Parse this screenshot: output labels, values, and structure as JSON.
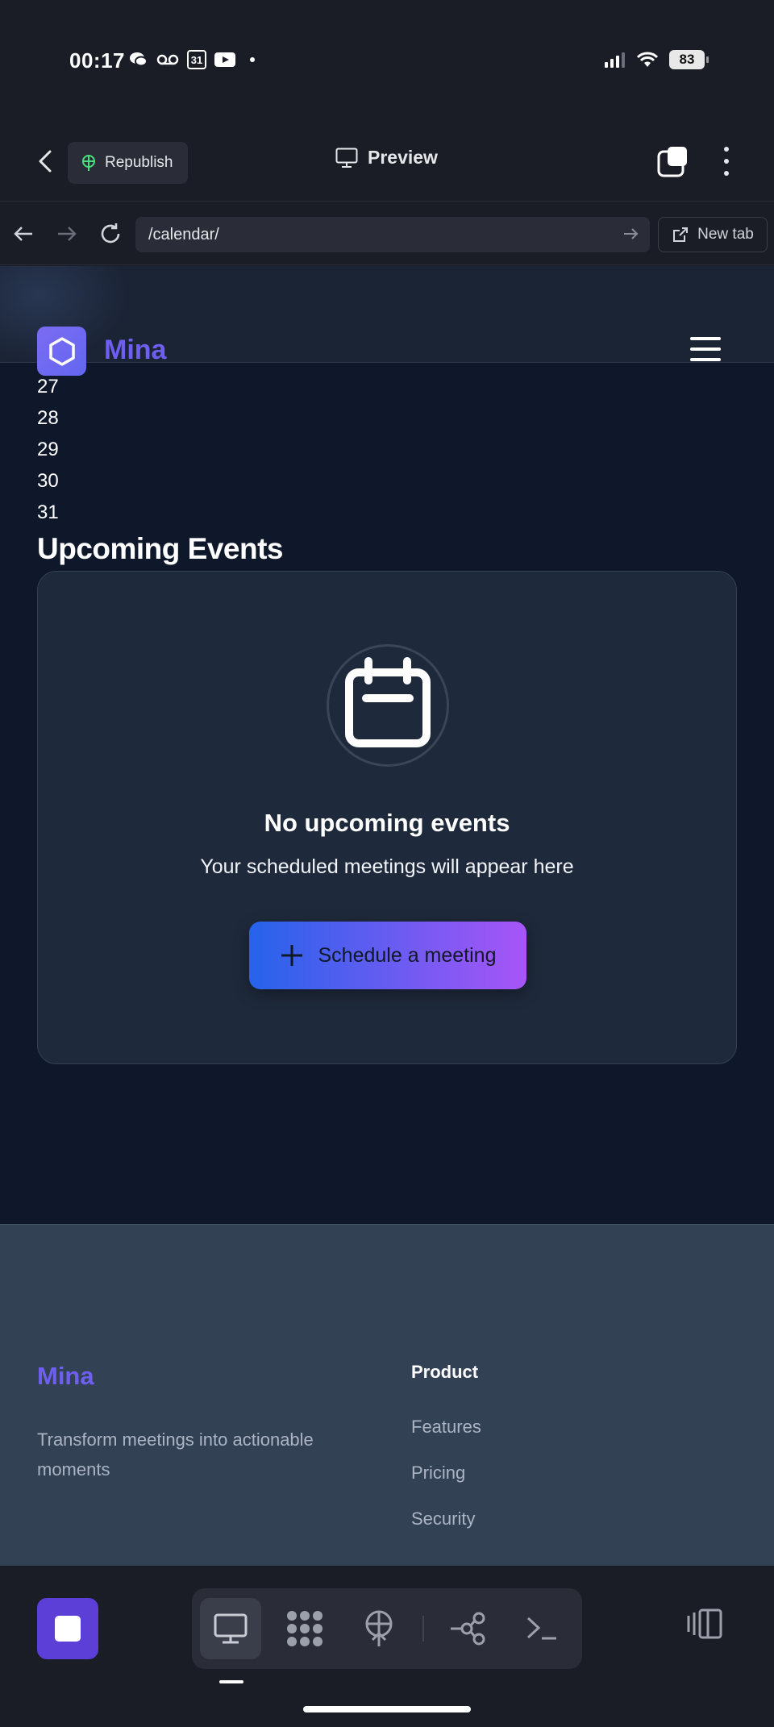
{
  "status_bar": {
    "time": "00:17",
    "calendar_day": "31",
    "battery": "83"
  },
  "app_bar": {
    "republish_label": "Republish",
    "preview_label": "Preview"
  },
  "browser": {
    "url": "/calendar/",
    "new_tab_label": "New tab"
  },
  "site": {
    "brand": "Mina",
    "days": [
      "27",
      "28",
      "29",
      "30",
      "31"
    ],
    "section_title": "Upcoming Events",
    "empty_state": {
      "heading": "No upcoming events",
      "subtext": "Your scheduled meetings will appear here",
      "button_label": "Schedule a meeting"
    },
    "footer": {
      "brand": "Mina",
      "tagline": "Transform meetings into actionable moments",
      "product_title": "Product",
      "product_links": [
        "Features",
        "Pricing",
        "Security"
      ]
    }
  },
  "colors": {
    "brand_purple": "#6f5ff0",
    "page_bg": "#0f172a",
    "card_bg": "#1e293b",
    "footer_bg": "#334155",
    "button_gradient_start": "#2563eb",
    "button_gradient_end": "#a855f7"
  },
  "icons": {
    "status_left": [
      "chat-bubbles-icon",
      "voicemail-icon",
      "calendar-icon",
      "youtube-icon",
      "dot-icon"
    ],
    "status_right": [
      "signal-icon",
      "wifi-icon",
      "battery-icon"
    ],
    "toolbar": [
      "desktop-icon",
      "apps-icon",
      "deploy-icon",
      "git-icon",
      "terminal-icon"
    ]
  }
}
